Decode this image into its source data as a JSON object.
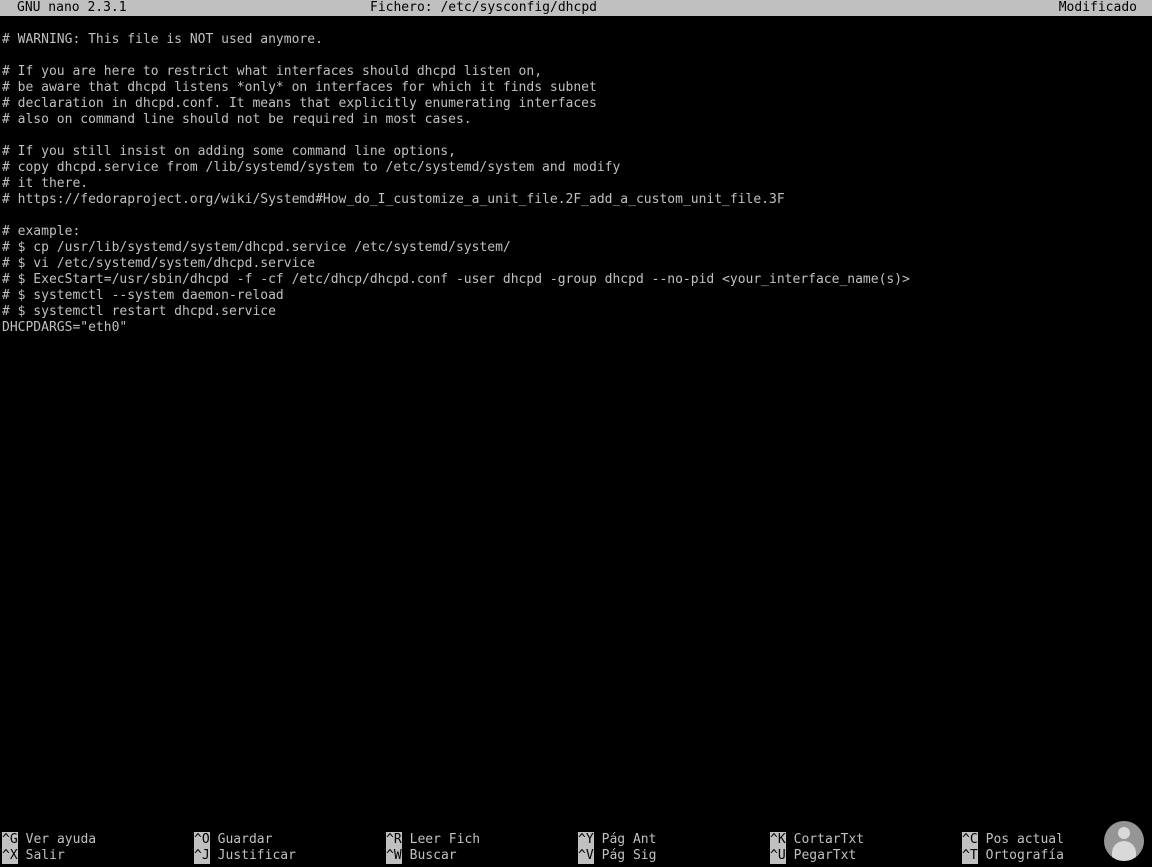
{
  "titlebar": {
    "app": "GNU nano 2.3.1",
    "file": "Fichero: /etc/sysconfig/dhcpd",
    "status": "Modificado"
  },
  "editor": {
    "lines": [
      "# WARNING: This file is NOT used anymore.",
      "",
      "# If you are here to restrict what interfaces should dhcpd listen on,",
      "# be aware that dhcpd listens *only* on interfaces for which it finds subnet",
      "# declaration in dhcpd.conf. It means that explicitly enumerating interfaces",
      "# also on command line should not be required in most cases.",
      "",
      "# If you still insist on adding some command line options,",
      "# copy dhcpd.service from /lib/systemd/system to /etc/systemd/system and modify",
      "# it there.",
      "# https://fedoraproject.org/wiki/Systemd#How_do_I_customize_a_unit_file.2F_add_a_custom_unit_file.3F",
      "",
      "# example:",
      "# $ cp /usr/lib/systemd/system/dhcpd.service /etc/systemd/system/",
      "# $ vi /etc/systemd/system/dhcpd.service",
      "# $ ExecStart=/usr/sbin/dhcpd -f -cf /etc/dhcp/dhcpd.conf -user dhcpd -group dhcpd --no-pid <your_interface_name(s)>",
      "# $ systemctl --system daemon-reload",
      "# $ systemctl restart dhcpd.service",
      "DHCPDARGS=\"eth0\""
    ]
  },
  "shortcuts": [
    {
      "key": "^G",
      "label": "Ver ayuda"
    },
    {
      "key": "^X",
      "label": "Salir"
    },
    {
      "key": "^O",
      "label": "Guardar"
    },
    {
      "key": "^J",
      "label": "Justificar"
    },
    {
      "key": "^R",
      "label": "Leer Fich"
    },
    {
      "key": "^W",
      "label": "Buscar"
    },
    {
      "key": "^Y",
      "label": "Pág Ant"
    },
    {
      "key": "^V",
      "label": "Pág Sig"
    },
    {
      "key": "^K",
      "label": "CortarTxt"
    },
    {
      "key": "^U",
      "label": "PegarTxt"
    },
    {
      "key": "^C",
      "label": "Pos actual"
    },
    {
      "key": "^T",
      "label": "Ortografía"
    }
  ],
  "colors": {
    "background": "#000000",
    "foreground": "#c0c0c0",
    "inverse_bg": "#c0c0c0",
    "inverse_fg": "#000000"
  },
  "watermark_icon": "person-logo-icon"
}
